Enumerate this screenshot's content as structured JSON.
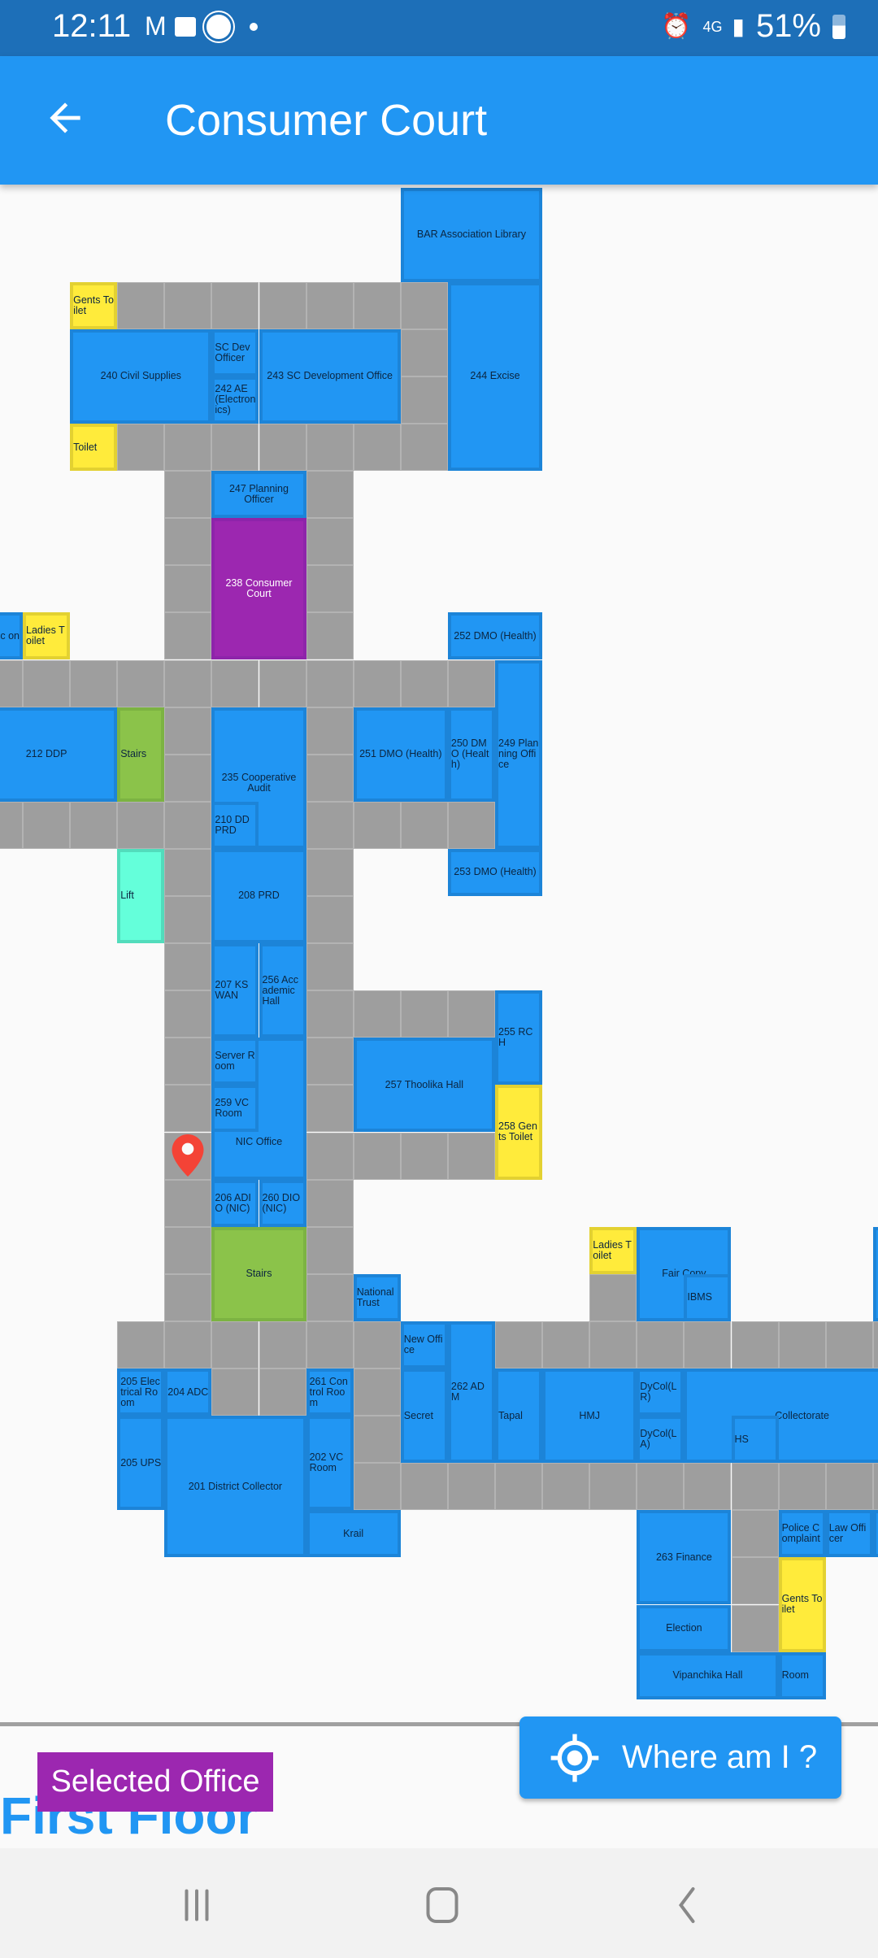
{
  "status_bar": {
    "time": "12:11",
    "battery": "51%",
    "network": "4G",
    "notification_icons": [
      "gmail-icon",
      "gallery-icon",
      "app-icon",
      "dot-icon"
    ],
    "system_icons": [
      "alarm-icon",
      "4g-icon",
      "signal-icon",
      "battery-icon"
    ]
  },
  "app_bar": {
    "title": "Consumer Court",
    "back_icon": "arrow-left-icon"
  },
  "map": {
    "colors": {
      "office": "#2196f3",
      "corridor": "#9e9e9e",
      "toilet": "#ffeb3b",
      "stairs": "#8bc34a",
      "lift": "#64ffda",
      "selected": "#9c27b0",
      "pin": "#f44336"
    },
    "rooms": [
      {
        "label": "BAR Association Library",
        "type": "office"
      },
      {
        "label": "Gents Toilet",
        "type": "toilet"
      },
      {
        "label": "244 Excise",
        "type": "office"
      },
      {
        "label": "240 Civil Supplies",
        "type": "office"
      },
      {
        "label": "SC Dev Officer",
        "type": "office"
      },
      {
        "label": "242 AE (Electronics)",
        "type": "office"
      },
      {
        "label": "243 SC Development Office",
        "type": "office"
      },
      {
        "label": "Toilet",
        "type": "toilet"
      },
      {
        "label": "247 Planning Officer",
        "type": "office"
      },
      {
        "label": "238 Consumer Court",
        "type": "selected"
      },
      {
        "label": "ortic on",
        "type": "office"
      },
      {
        "label": "Ladies Toilet",
        "type": "toilet"
      },
      {
        "label": "252 DMO (Health)",
        "type": "office"
      },
      {
        "label": "249 Planning Office",
        "type": "office"
      },
      {
        "label": "212 DDP",
        "type": "office"
      },
      {
        "label": "Stairs",
        "type": "stairs"
      },
      {
        "label": "235 Cooperative Audit",
        "type": "office"
      },
      {
        "label": "210 DD PRD",
        "type": "office"
      },
      {
        "label": "251 DMO (Health)",
        "type": "office"
      },
      {
        "label": "250 DMO (Health)",
        "type": "office"
      },
      {
        "label": "Lift",
        "type": "lift"
      },
      {
        "label": "208 PRD",
        "type": "office"
      },
      {
        "label": "253 DMO (Health)",
        "type": "office"
      },
      {
        "label": "207 KSWAN",
        "type": "office"
      },
      {
        "label": "256 Accademic Hall",
        "type": "office"
      },
      {
        "label": "255 RCH",
        "type": "office"
      },
      {
        "label": "NIC Office",
        "type": "office"
      },
      {
        "label": "Server Room",
        "type": "office"
      },
      {
        "label": "259 VC Room",
        "type": "office"
      },
      {
        "label": "257 Thoolika Hall",
        "type": "office"
      },
      {
        "label": "258 Gents Toilet",
        "type": "toilet"
      },
      {
        "label": "206 ADIO (NIC)",
        "type": "office"
      },
      {
        "label": "260 DIO (NIC)",
        "type": "office"
      },
      {
        "label": "Stairs",
        "type": "stairs"
      },
      {
        "label": "National Trust",
        "type": "office"
      },
      {
        "label": "Ladies Toilet",
        "type": "toilet"
      },
      {
        "label": "Fair Copy",
        "type": "office"
      },
      {
        "label": "IBMS",
        "type": "office"
      },
      {
        "label": "New Office",
        "type": "office"
      },
      {
        "label": "262 ADM",
        "type": "office"
      },
      {
        "label": "205 Electrical Room",
        "type": "office"
      },
      {
        "label": "204 ADC",
        "type": "office"
      },
      {
        "label": "261 Control Room",
        "type": "office"
      },
      {
        "label": "Secret",
        "type": "office"
      },
      {
        "label": "Tapal",
        "type": "office"
      },
      {
        "label": "HMJ",
        "type": "office"
      },
      {
        "label": "DyCol(LR)",
        "type": "office"
      },
      {
        "label": "DyCol(LA)",
        "type": "office"
      },
      {
        "label": "Collectorate",
        "type": "office"
      },
      {
        "label": "HS",
        "type": "office"
      },
      {
        "label": "205 UPS",
        "type": "office"
      },
      {
        "label": "201 District Collector",
        "type": "office"
      },
      {
        "label": "202 VC Room",
        "type": "office"
      },
      {
        "label": "Krail",
        "type": "office"
      },
      {
        "label": "263 Finance",
        "type": "office"
      },
      {
        "label": "Police Complaint",
        "type": "office"
      },
      {
        "label": "Law Officer",
        "type": "office"
      },
      {
        "label": "Gents Toilet",
        "type": "toilet"
      },
      {
        "label": "Election",
        "type": "office"
      },
      {
        "label": "Vipanchika Hall",
        "type": "office"
      },
      {
        "label": "Room",
        "type": "office"
      }
    ],
    "pin_icon": "map-pin-icon"
  },
  "where_button": {
    "label": "Where am I ?",
    "icon": "gps-crosshair-icon"
  },
  "legend": {
    "selected_office": "Selected Office"
  },
  "floor_label": "First Floor",
  "nav_bar": {
    "buttons": [
      "recent-apps-icon",
      "home-icon",
      "back-icon"
    ]
  }
}
